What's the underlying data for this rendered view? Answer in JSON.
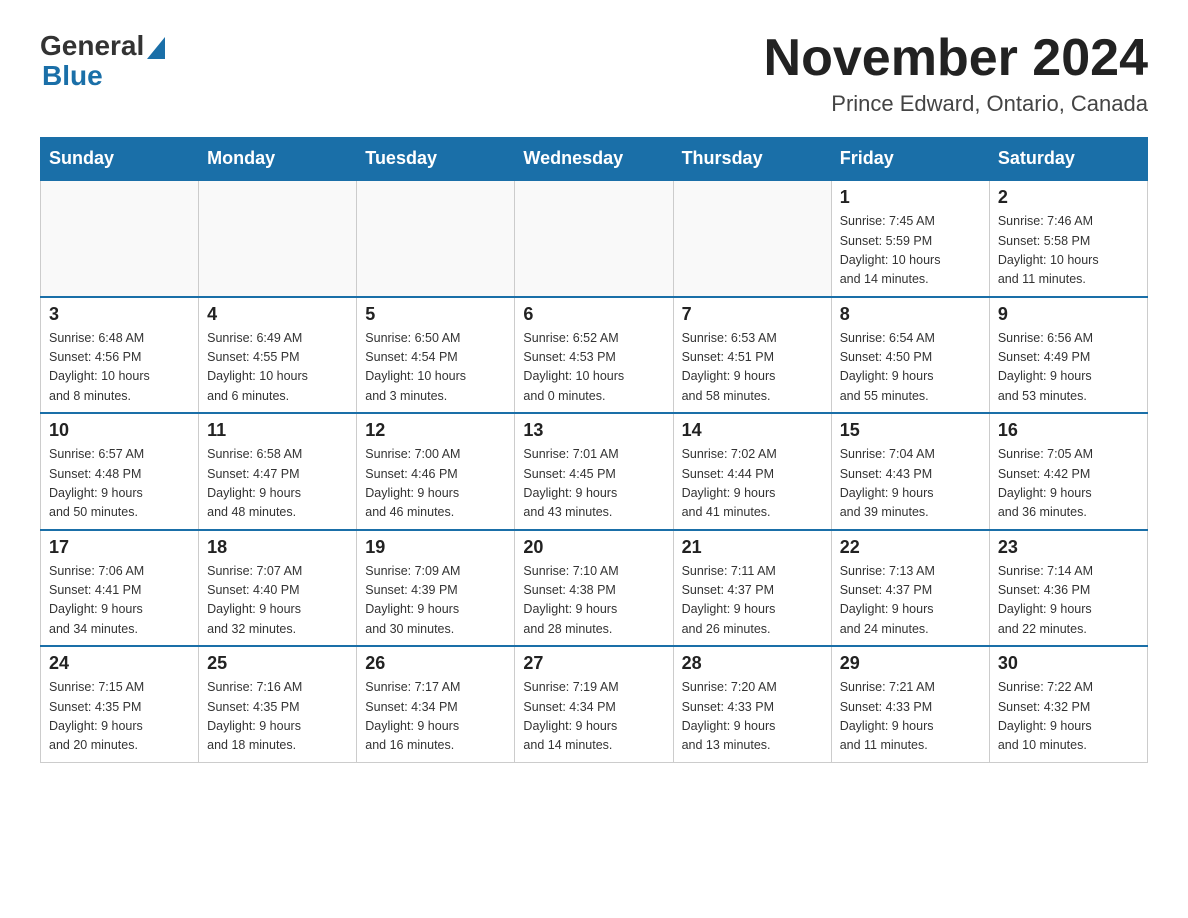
{
  "header": {
    "logo_general": "General",
    "logo_blue": "Blue",
    "month_title": "November 2024",
    "location": "Prince Edward, Ontario, Canada"
  },
  "weekdays": [
    "Sunday",
    "Monday",
    "Tuesday",
    "Wednesday",
    "Thursday",
    "Friday",
    "Saturday"
  ],
  "weeks": [
    [
      {
        "day": "",
        "info": ""
      },
      {
        "day": "",
        "info": ""
      },
      {
        "day": "",
        "info": ""
      },
      {
        "day": "",
        "info": ""
      },
      {
        "day": "",
        "info": ""
      },
      {
        "day": "1",
        "info": "Sunrise: 7:45 AM\nSunset: 5:59 PM\nDaylight: 10 hours\nand 14 minutes."
      },
      {
        "day": "2",
        "info": "Sunrise: 7:46 AM\nSunset: 5:58 PM\nDaylight: 10 hours\nand 11 minutes."
      }
    ],
    [
      {
        "day": "3",
        "info": "Sunrise: 6:48 AM\nSunset: 4:56 PM\nDaylight: 10 hours\nand 8 minutes."
      },
      {
        "day": "4",
        "info": "Sunrise: 6:49 AM\nSunset: 4:55 PM\nDaylight: 10 hours\nand 6 minutes."
      },
      {
        "day": "5",
        "info": "Sunrise: 6:50 AM\nSunset: 4:54 PM\nDaylight: 10 hours\nand 3 minutes."
      },
      {
        "day": "6",
        "info": "Sunrise: 6:52 AM\nSunset: 4:53 PM\nDaylight: 10 hours\nand 0 minutes."
      },
      {
        "day": "7",
        "info": "Sunrise: 6:53 AM\nSunset: 4:51 PM\nDaylight: 9 hours\nand 58 minutes."
      },
      {
        "day": "8",
        "info": "Sunrise: 6:54 AM\nSunset: 4:50 PM\nDaylight: 9 hours\nand 55 minutes."
      },
      {
        "day": "9",
        "info": "Sunrise: 6:56 AM\nSunset: 4:49 PM\nDaylight: 9 hours\nand 53 minutes."
      }
    ],
    [
      {
        "day": "10",
        "info": "Sunrise: 6:57 AM\nSunset: 4:48 PM\nDaylight: 9 hours\nand 50 minutes."
      },
      {
        "day": "11",
        "info": "Sunrise: 6:58 AM\nSunset: 4:47 PM\nDaylight: 9 hours\nand 48 minutes."
      },
      {
        "day": "12",
        "info": "Sunrise: 7:00 AM\nSunset: 4:46 PM\nDaylight: 9 hours\nand 46 minutes."
      },
      {
        "day": "13",
        "info": "Sunrise: 7:01 AM\nSunset: 4:45 PM\nDaylight: 9 hours\nand 43 minutes."
      },
      {
        "day": "14",
        "info": "Sunrise: 7:02 AM\nSunset: 4:44 PM\nDaylight: 9 hours\nand 41 minutes."
      },
      {
        "day": "15",
        "info": "Sunrise: 7:04 AM\nSunset: 4:43 PM\nDaylight: 9 hours\nand 39 minutes."
      },
      {
        "day": "16",
        "info": "Sunrise: 7:05 AM\nSunset: 4:42 PM\nDaylight: 9 hours\nand 36 minutes."
      }
    ],
    [
      {
        "day": "17",
        "info": "Sunrise: 7:06 AM\nSunset: 4:41 PM\nDaylight: 9 hours\nand 34 minutes."
      },
      {
        "day": "18",
        "info": "Sunrise: 7:07 AM\nSunset: 4:40 PM\nDaylight: 9 hours\nand 32 minutes."
      },
      {
        "day": "19",
        "info": "Sunrise: 7:09 AM\nSunset: 4:39 PM\nDaylight: 9 hours\nand 30 minutes."
      },
      {
        "day": "20",
        "info": "Sunrise: 7:10 AM\nSunset: 4:38 PM\nDaylight: 9 hours\nand 28 minutes."
      },
      {
        "day": "21",
        "info": "Sunrise: 7:11 AM\nSunset: 4:37 PM\nDaylight: 9 hours\nand 26 minutes."
      },
      {
        "day": "22",
        "info": "Sunrise: 7:13 AM\nSunset: 4:37 PM\nDaylight: 9 hours\nand 24 minutes."
      },
      {
        "day": "23",
        "info": "Sunrise: 7:14 AM\nSunset: 4:36 PM\nDaylight: 9 hours\nand 22 minutes."
      }
    ],
    [
      {
        "day": "24",
        "info": "Sunrise: 7:15 AM\nSunset: 4:35 PM\nDaylight: 9 hours\nand 20 minutes."
      },
      {
        "day": "25",
        "info": "Sunrise: 7:16 AM\nSunset: 4:35 PM\nDaylight: 9 hours\nand 18 minutes."
      },
      {
        "day": "26",
        "info": "Sunrise: 7:17 AM\nSunset: 4:34 PM\nDaylight: 9 hours\nand 16 minutes."
      },
      {
        "day": "27",
        "info": "Sunrise: 7:19 AM\nSunset: 4:34 PM\nDaylight: 9 hours\nand 14 minutes."
      },
      {
        "day": "28",
        "info": "Sunrise: 7:20 AM\nSunset: 4:33 PM\nDaylight: 9 hours\nand 13 minutes."
      },
      {
        "day": "29",
        "info": "Sunrise: 7:21 AM\nSunset: 4:33 PM\nDaylight: 9 hours\nand 11 minutes."
      },
      {
        "day": "30",
        "info": "Sunrise: 7:22 AM\nSunset: 4:32 PM\nDaylight: 9 hours\nand 10 minutes."
      }
    ]
  ]
}
